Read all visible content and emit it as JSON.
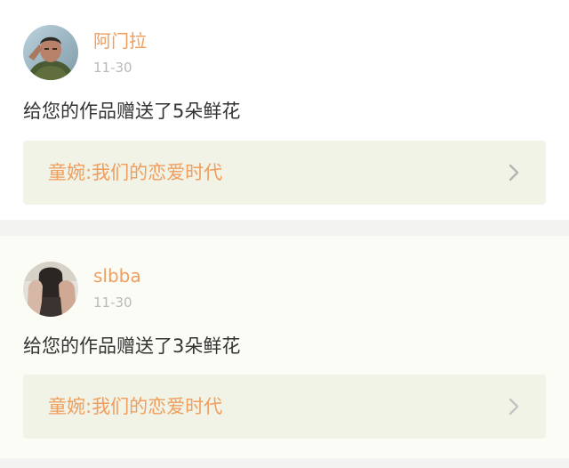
{
  "notifications": [
    {
      "username": "阿门拉",
      "date": "11-30",
      "message": "给您的作品赠送了5朵鲜花",
      "work_title": "童婉:我们的恋爱时代"
    },
    {
      "username": "slbba",
      "date": "11-30",
      "message": "给您的作品赠送了3朵鲜花",
      "work_title": "童婉:我们的恋爱时代"
    }
  ],
  "colors": {
    "accent": "#ef9e5e",
    "page_background": "#f3f3f1",
    "link_background": "#f1f3e6"
  },
  "icons": {
    "link_arrow": "chevron-right-icon"
  }
}
